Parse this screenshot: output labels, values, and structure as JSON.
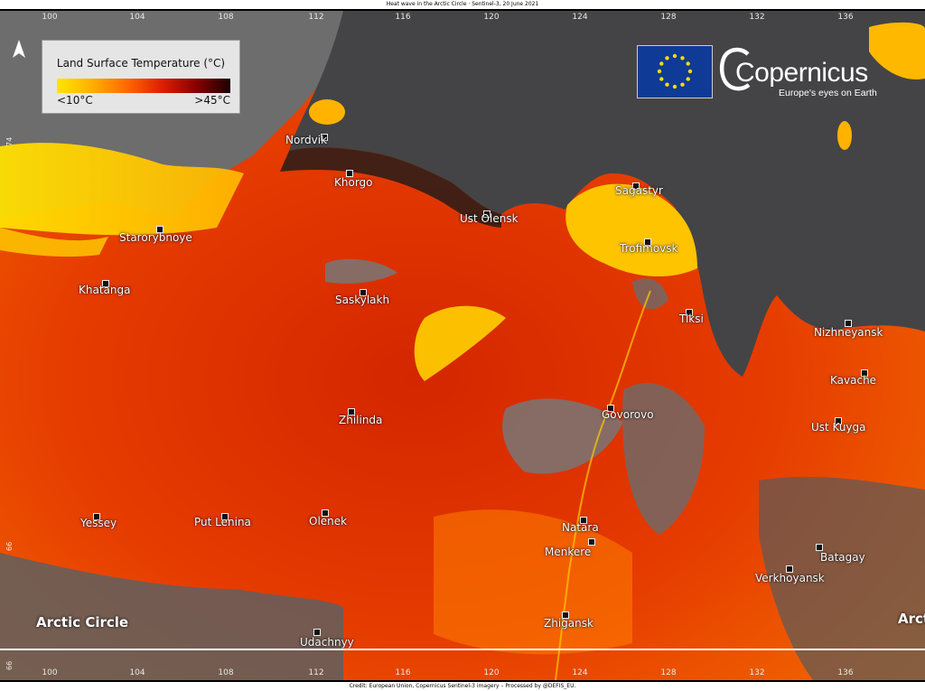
{
  "header": {
    "title": "Heat wave in the Arctic Circle · Sentinel-3, 20 June 2021"
  },
  "footer": {
    "credit": "Credit: European Union, Copernicus Sentinel-3 imagery – Processed by @DEFIS_EU."
  },
  "legend": {
    "title": "Land Surface Temperature (°C)",
    "min_label": "<10°C",
    "max_label": ">45°C",
    "gradient_colors": [
      "#ffe600",
      "#ffb000",
      "#ff6a00",
      "#e02000",
      "#8a0000",
      "#1a0000"
    ]
  },
  "branding": {
    "logo_word": "Copernicus",
    "tagline": "Europe's eyes on Earth",
    "eu_flag_colors": {
      "field": "#0f3a96",
      "stars": "#ffdd00"
    }
  },
  "longitudes": [
    "100",
    "104",
    "108",
    "112",
    "116",
    "120",
    "124",
    "128",
    "132",
    "136"
  ],
  "latitudes": [
    "74",
    "66",
    "66"
  ],
  "arctic_circle": {
    "left_label": "Arctic Circle",
    "right_label": "Arct"
  },
  "cities": [
    {
      "name": "Nordvik"
    },
    {
      "name": "Khorgo"
    },
    {
      "name": "Ust Olensk"
    },
    {
      "name": "Sagastyr"
    },
    {
      "name": "Starorybnoye"
    },
    {
      "name": "Trofimovsk"
    },
    {
      "name": "Khatanga"
    },
    {
      "name": "Saskylakh"
    },
    {
      "name": "Tiksi"
    },
    {
      "name": "Nizhneyansk"
    },
    {
      "name": "Kavache"
    },
    {
      "name": "Zhilinda"
    },
    {
      "name": "Govorovo"
    },
    {
      "name": "Ust Kuyga"
    },
    {
      "name": "Yessey"
    },
    {
      "name": "Put Lenina"
    },
    {
      "name": "Olenek"
    },
    {
      "name": "Natara"
    },
    {
      "name": "Menkere"
    },
    {
      "name": "Batagay"
    },
    {
      "name": "Verkhoyansk"
    },
    {
      "name": "Zhigansk"
    },
    {
      "name": "Udachnyy"
    }
  ],
  "colors": {
    "sea": "#444446",
    "hot_land": "#e03200",
    "warm_land": "#f05a00",
    "cool_land": "#ffd000",
    "bare_ground": "#6a6a6a"
  }
}
